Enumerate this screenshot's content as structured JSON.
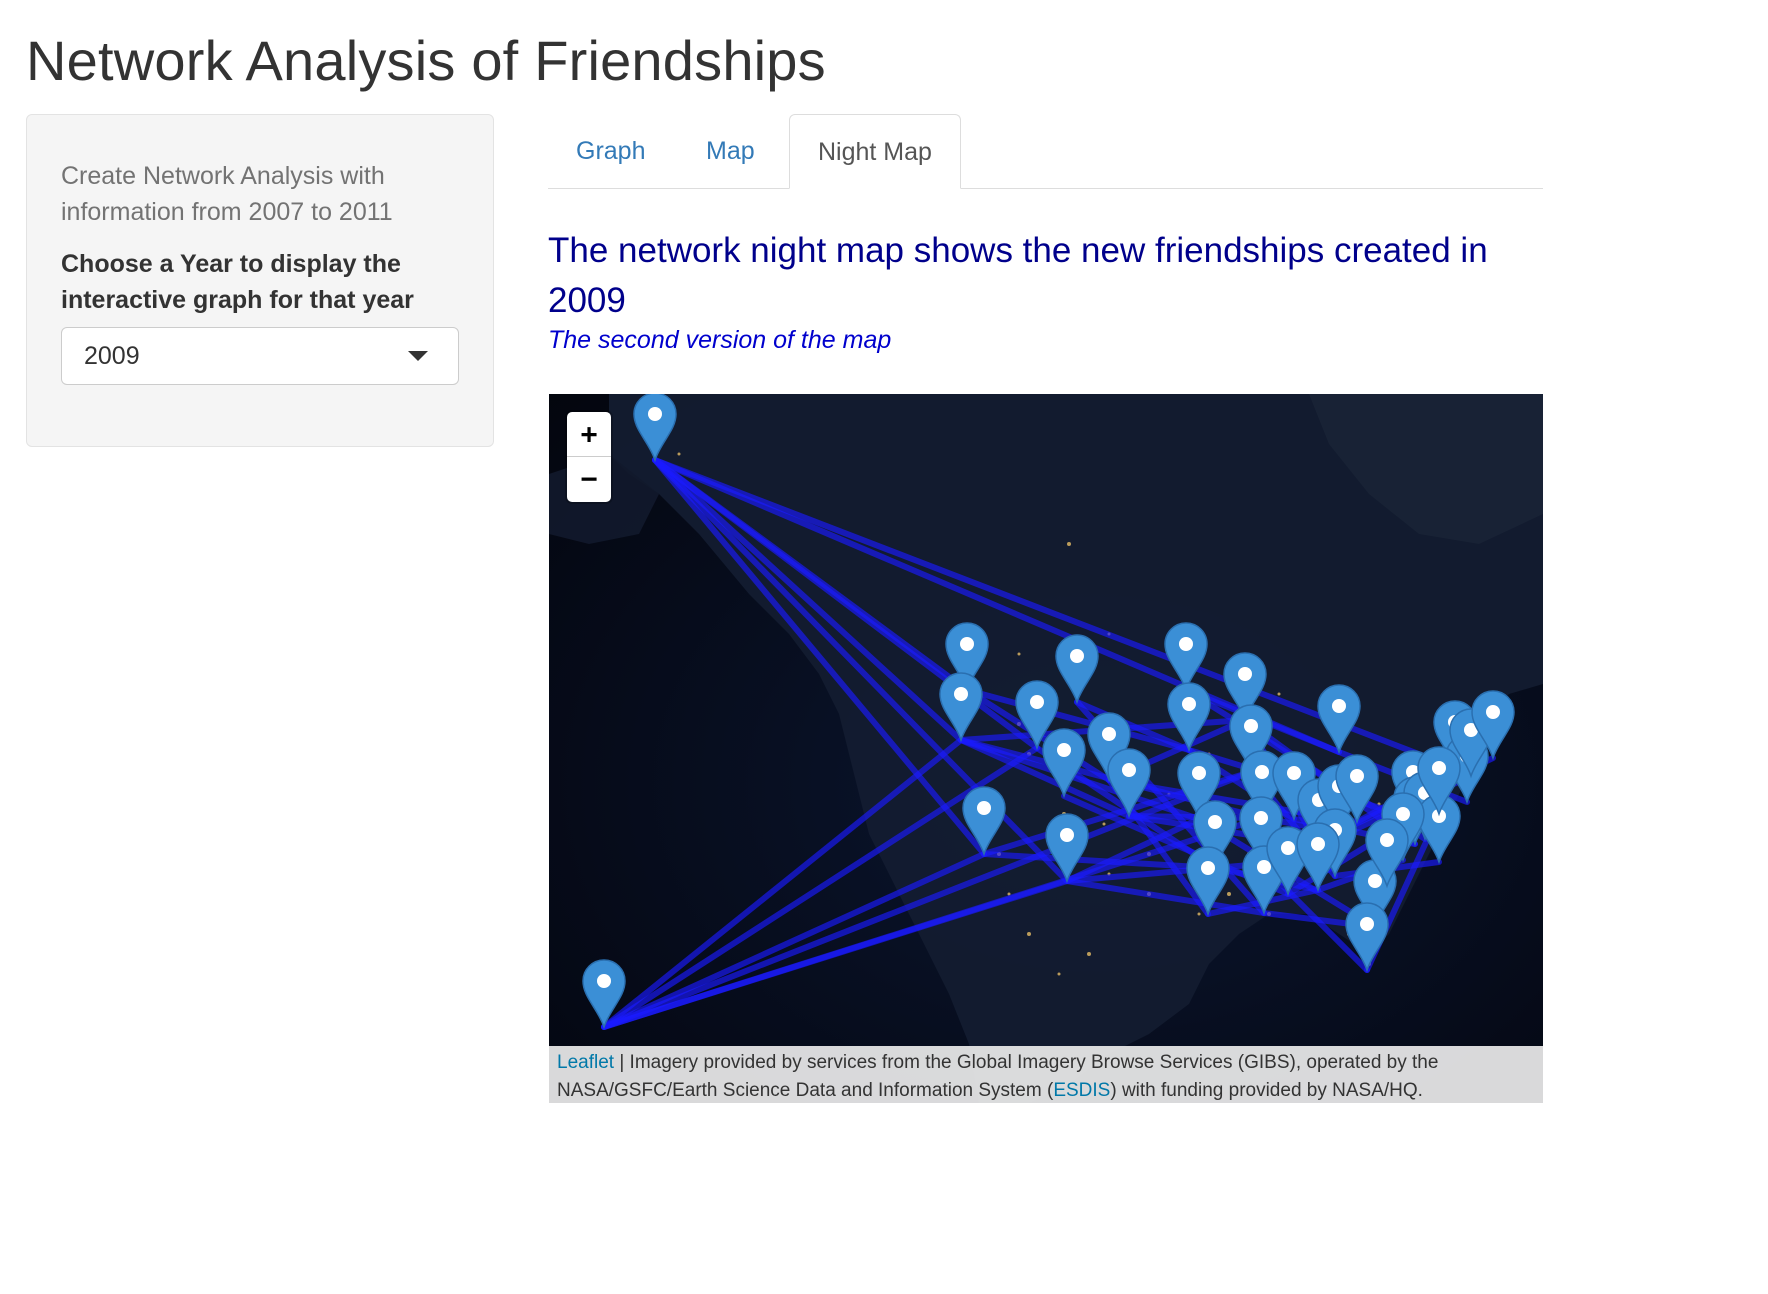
{
  "page": {
    "title": "Network Analysis of Friendships"
  },
  "sidebar": {
    "help_text": "Create Network Analysis with information from 2007 to 2011",
    "year_label": "Choose a Year to display the interactive graph for that year",
    "year_select": {
      "selected": "2009",
      "caret_icon": "caret-down-icon"
    }
  },
  "tabs": [
    {
      "label": "Graph",
      "active": false
    },
    {
      "label": "Map",
      "active": false
    },
    {
      "label": "Night Map",
      "active": true
    }
  ],
  "main": {
    "heading": "The network night map shows the new friendships created in 2009",
    "subtitle": "The second version of the map"
  },
  "map": {
    "zoom_in_label": "+",
    "zoom_out_label": "−",
    "marker_icon": "map-marker-icon",
    "marker_color": "#3b8fd6",
    "edge_color": "#1a1aff",
    "background_color": "#04060f",
    "attribution": {
      "leaflet_link": "Leaflet",
      "separator": " | ",
      "text_before": "Imagery provided by services from the Global Imagery Browse Services (GIBS), operated by the NASA/GSFC/Earth Science Data and Information System (",
      "esdis_link": "ESDIS",
      "text_after": ") with funding provided by NASA/HQ."
    }
  }
}
